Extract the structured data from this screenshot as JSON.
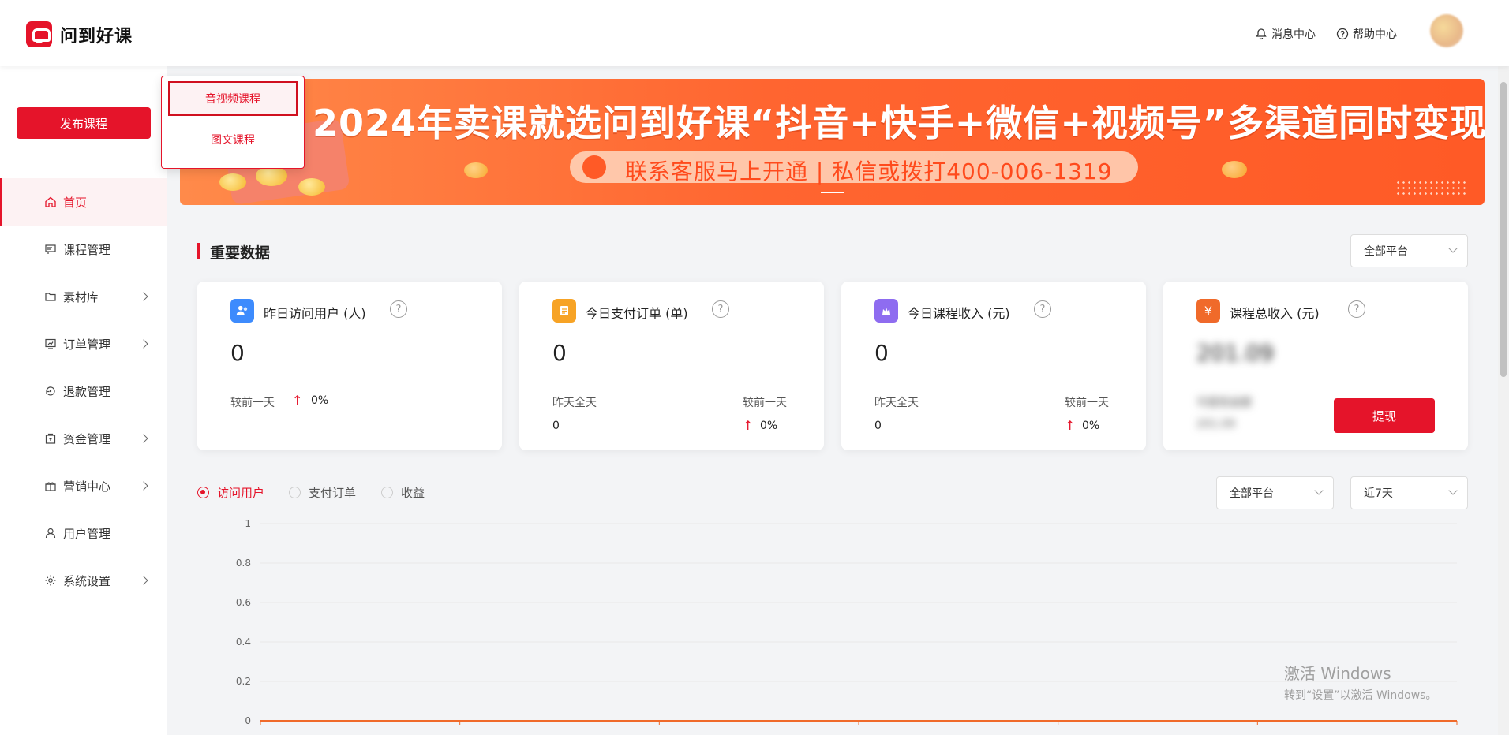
{
  "app": {
    "logo_text": "问到好课"
  },
  "header": {
    "messages": "消息中心",
    "help": "帮助中心"
  },
  "sidebar": {
    "publish_label": "发布课程",
    "items": [
      {
        "label": "首页",
        "icon": "home-icon",
        "active": true,
        "has_submenu": false
      },
      {
        "label": "课程管理",
        "icon": "course-icon",
        "has_submenu": false
      },
      {
        "label": "素材库",
        "icon": "folder-icon",
        "has_submenu": true
      },
      {
        "label": "订单管理",
        "icon": "order-icon",
        "has_submenu": true
      },
      {
        "label": "退款管理",
        "icon": "refund-icon",
        "has_submenu": false
      },
      {
        "label": "资金管理",
        "icon": "wallet-icon",
        "has_submenu": true
      },
      {
        "label": "营销中心",
        "icon": "gift-icon",
        "has_submenu": true
      },
      {
        "label": "用户管理",
        "icon": "user-icon",
        "has_submenu": false
      },
      {
        "label": "系统设置",
        "icon": "gear-icon",
        "has_submenu": true
      }
    ]
  },
  "publish_menu": {
    "items": [
      "音视频课程",
      "图文课程"
    ],
    "highlighted": 0
  },
  "banner": {
    "title": "2024年卖课就选问到好课“抖音+快手+微信+视频号”多渠道同时变现!",
    "subtitle": "联系客服马上开通 | 私信或拨打400-006-1319"
  },
  "data_section": {
    "title": "重要数据",
    "platform_select": "全部平台"
  },
  "cards": [
    {
      "title": "昨日访问用户 (人)",
      "value": "0",
      "compare_label": "较前一天",
      "compare_value": "0%",
      "icon_color": "#3d8bfd",
      "icon_glyph": "👥"
    },
    {
      "title": "今日支付订单 (单)",
      "value": "0",
      "yesterday_label": "昨天全天",
      "yesterday_value": "0",
      "compare_label": "较前一天",
      "compare_value": "0%",
      "icon_color": "#f7a325",
      "icon_glyph": "▤"
    },
    {
      "title": "今日课程收入 (元)",
      "value": "0",
      "yesterday_label": "昨天全天",
      "yesterday_value": "0",
      "compare_label": "较前一天",
      "compare_value": "0%",
      "icon_color": "#8e6cf0",
      "icon_glyph": "♛"
    },
    {
      "title": "课程总收入 (元)",
      "value": "201.09",
      "blurred_line1": "可提现金额",
      "blurred_line2": "201.09",
      "withdraw_label": "提现",
      "icon_color": "#f06a2a",
      "icon_glyph": "¥"
    }
  ],
  "chart_controls": {
    "tabs": [
      "访问用户",
      "支付订单",
      "收益"
    ],
    "selected_tab": 0,
    "platform": "全部平台",
    "range": "近7天"
  },
  "chart_data": {
    "type": "line",
    "y_ticks": [
      "1",
      "0.8",
      "0.6",
      "0.4",
      "0.2",
      "0"
    ],
    "ylim": [
      0,
      1
    ],
    "series": [
      {
        "values": [
          0,
          0,
          0,
          0,
          0,
          0,
          0
        ]
      }
    ],
    "grid": true,
    "color": "#f06a2a"
  },
  "watermark": {
    "line1": "激活 Windows",
    "line2": "转到“设置”以激活 Windows。"
  }
}
